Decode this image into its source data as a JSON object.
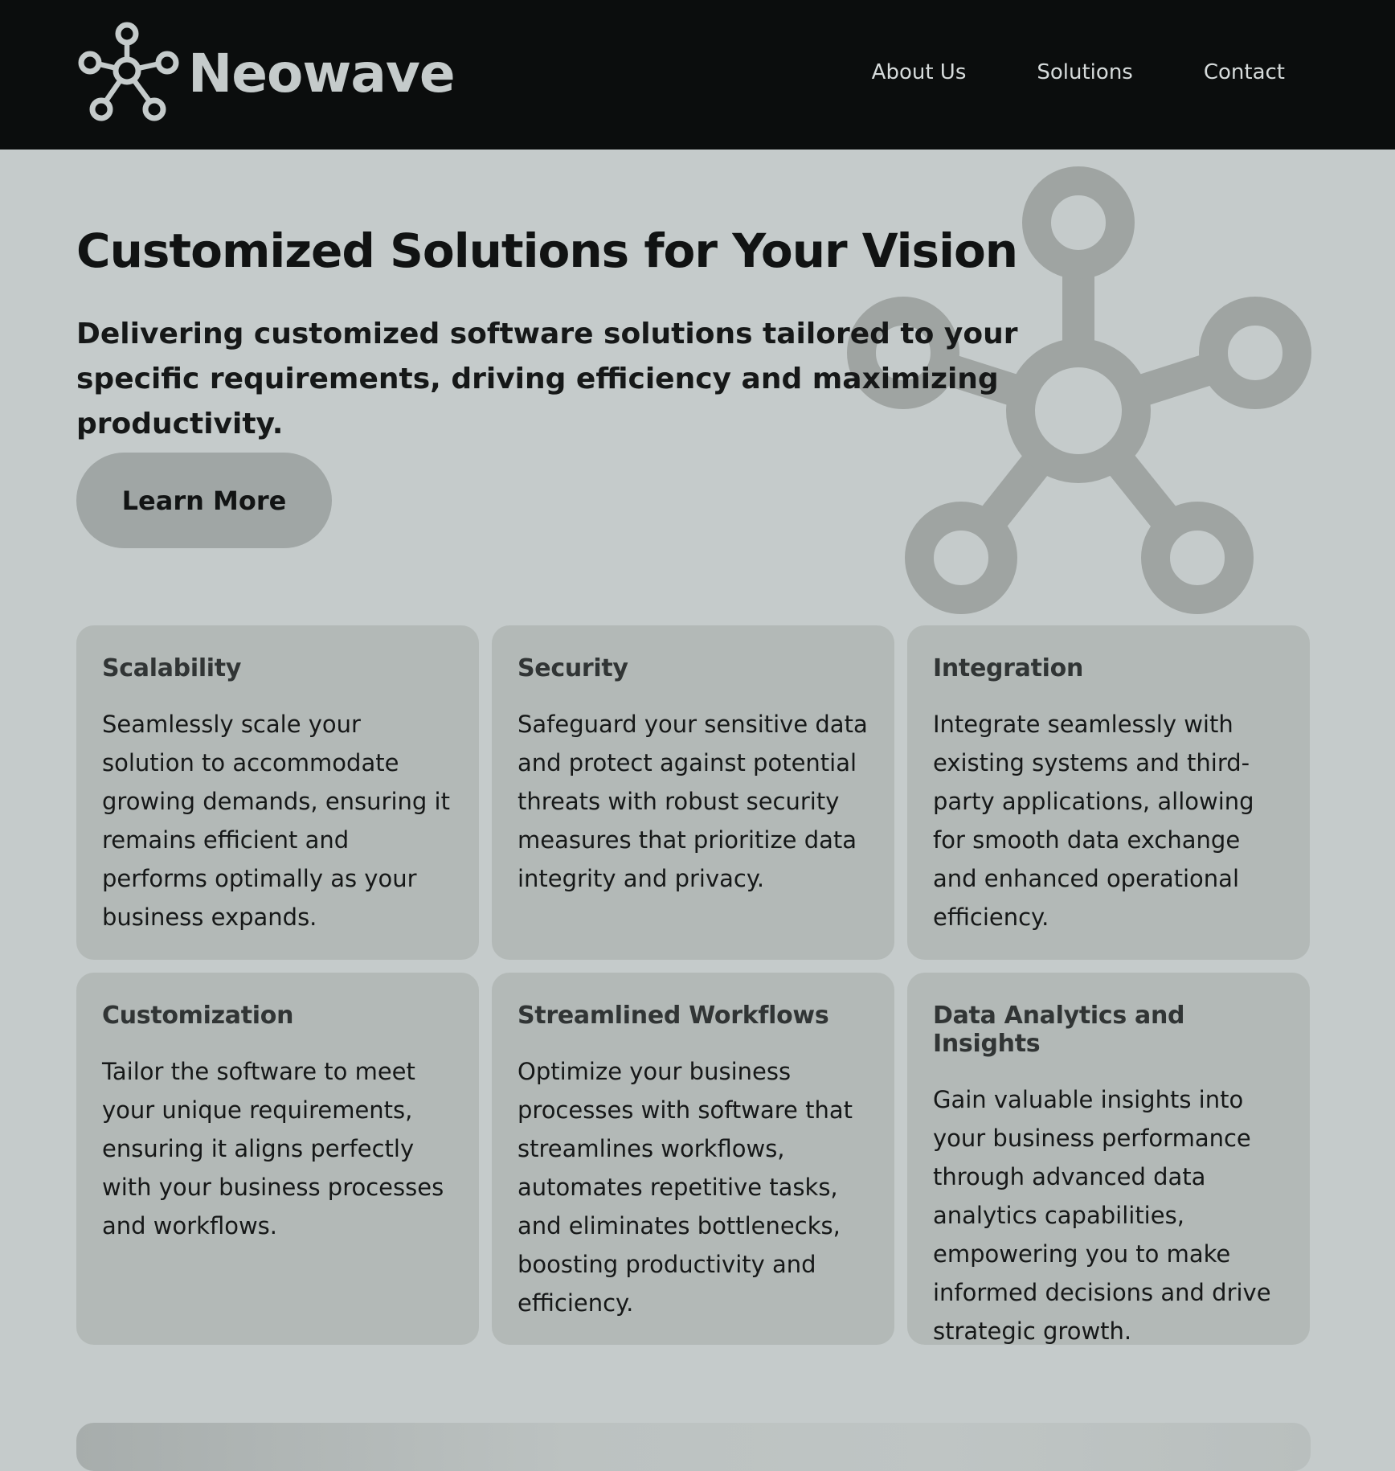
{
  "header": {
    "brand_name": "Neowave",
    "logo_icon": "network-hub-icon",
    "nav": [
      {
        "label": "About Us"
      },
      {
        "label": "Solutions"
      },
      {
        "label": "Contact"
      }
    ]
  },
  "hero": {
    "title": "Customized Solutions for Your Vision",
    "subtitle": "Delivering customized software solutions tailored to your specific requirements, driving efficiency and maximizing productivity.",
    "cta_label": "Learn More",
    "decor_icon": "network-hub-icon"
  },
  "features": [
    {
      "title": "Scalability",
      "text": "Seamlessly scale your solution to accommodate growing demands, ensuring it remains efficient and performs optimally as your business expands."
    },
    {
      "title": "Security",
      "text": "Safeguard your sensitive data and protect against potential threats with robust security measures that prioritize data integrity and privacy."
    },
    {
      "title": "Integration",
      "text": "Integrate seamlessly with existing systems and third-party applications, allowing for smooth data exchange and enhanced operational efficiency."
    },
    {
      "title": "Customization",
      "text": "Tailor the software to meet your unique requirements, ensuring it aligns perfectly with your business processes and workflows."
    },
    {
      "title": "Streamlined Workflows",
      "text": "Optimize your business processes with software that streamlines workflows, automates repetitive tasks, and eliminates bottlenecks, boosting productivity and efficiency."
    },
    {
      "title": "Data Analytics and Insights",
      "text": "Gain valuable insights into your business performance through advanced data analytics capabilities, empowering you to make informed decisions and drive strategic growth."
    }
  ],
  "colors": {
    "header_bg": "#0b0d0d",
    "page_bg": "#c5cbcb",
    "card_bg": "#b3b9b7",
    "button_bg": "#a0a6a5",
    "decor": "#9fa4a2"
  }
}
